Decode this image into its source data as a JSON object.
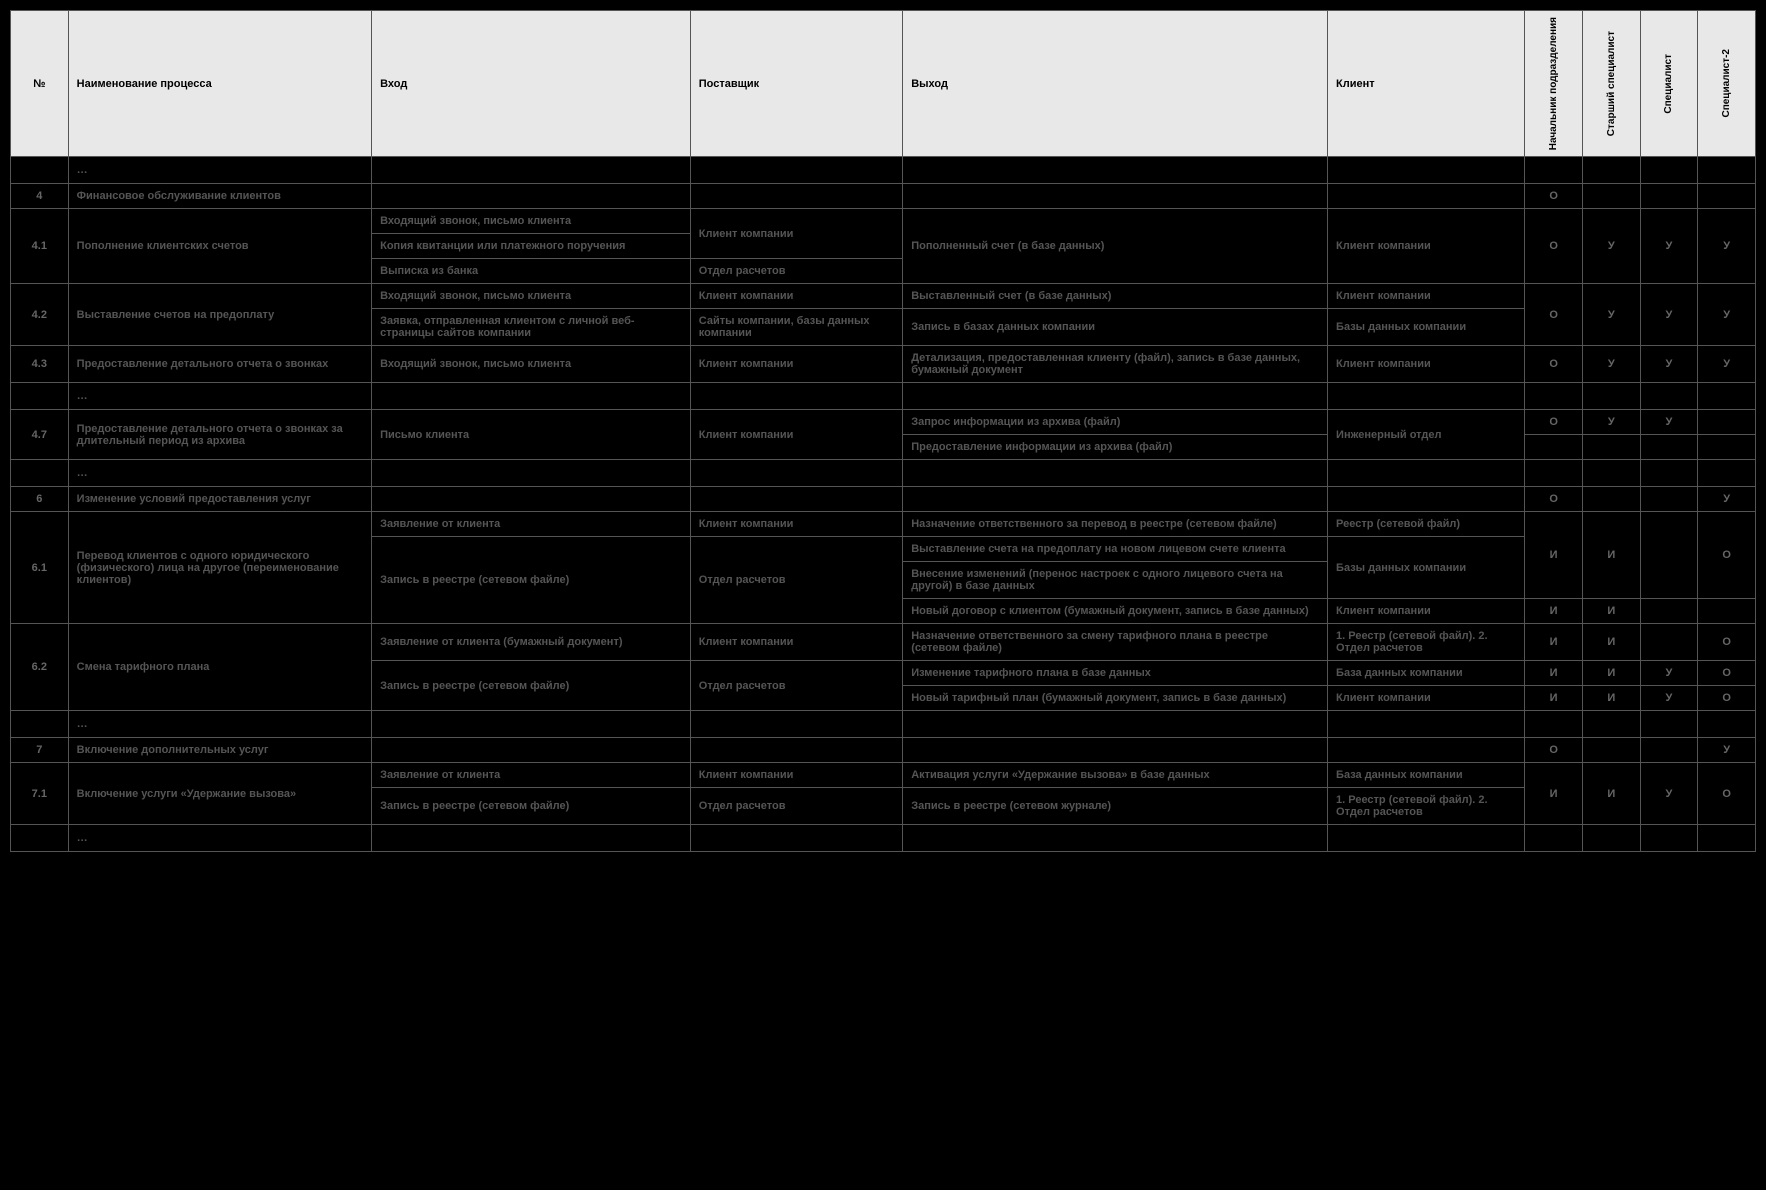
{
  "headers": {
    "num": "№",
    "name": "Наименование процесса",
    "input": "Вход",
    "supplier": "Поставщик",
    "output": "Выход",
    "client": "Клиент",
    "role1": "Начальник подразделения",
    "role2": "Старший специалист",
    "role3": "Специалист",
    "role4": "Специалист-2"
  },
  "rows": [
    {
      "type": "ellipsis",
      "text": "…"
    },
    {
      "type": "section",
      "num": "4",
      "name": "Финансовое обслуживание клиентов",
      "r1": "О",
      "r2": "",
      "r3": "",
      "r4": ""
    },
    {
      "type": "proc",
      "num": "4.1",
      "name": "Пополнение клиентских счетов",
      "subs": [
        {
          "input": "Входящий звонок, письмо клиента",
          "supplier": "Клиент компании",
          "output": "Пополненный счет (в базе данных)",
          "client": "Клиент компании"
        },
        {
          "input": "Копия квитанции или платежного поручения",
          "supplier": "",
          "output": "",
          "client": ""
        },
        {
          "input": "Выписка из банка",
          "supplier": "Отдел расчетов",
          "output": "",
          "client": ""
        }
      ],
      "r1": "О",
      "r2": "У",
      "r3": "У",
      "r4": "У",
      "merge": [
        {
          "col": "supplier",
          "from": 0,
          "span": 2
        },
        {
          "col": "output",
          "from": 0,
          "span": 3
        },
        {
          "col": "client",
          "from": 0,
          "span": 3
        }
      ]
    },
    {
      "type": "proc",
      "num": "4.2",
      "name": "Выставление счетов на предоплату",
      "subs": [
        {
          "input": "Входящий звонок, письмо клиента",
          "supplier": "Клиент компании",
          "output": "Выставленный счет (в базе данных)",
          "client": "Клиент компании"
        },
        {
          "input": "Заявка, отправленная клиентом с личной веб-страницы сайтов компании",
          "supplier": "Сайты компании, базы данных компании",
          "output": "Запись в базах данных компании",
          "client": "Базы данных  компании"
        }
      ],
      "r1": "О",
      "r2": "У",
      "r3": "У",
      "r4": "У"
    },
    {
      "type": "proc",
      "num": "4.3",
      "name": "Предоставление детального отчета о звонках",
      "subs": [
        {
          "input": "Входящий звонок, письмо клиента",
          "supplier": "Клиент компании",
          "output": "Детализация, предоставленная клиенту (файл), запись в базе данных, бумажный документ",
          "client": "Клиент компании"
        }
      ],
      "r1": "О",
      "r2": "У",
      "r3": "У",
      "r4": "У"
    },
    {
      "type": "ellipsis",
      "text": "…"
    },
    {
      "type": "proc",
      "num": "4.7",
      "name": "Предоставление детального отчета о звонках за длительный период из архива",
      "subs": [
        {
          "input": "Письмо клиента",
          "supplier": "Клиент компании",
          "output": "Запрос информации из архива (файл)",
          "client": "Инженерный отдел",
          "r1": "О",
          "r2": "У",
          "r3": "У",
          "r4": ""
        },
        {
          "input": "",
          "supplier": "",
          "output": "Предоставление информации из архива (файл)",
          "client": "",
          "r1": "",
          "r2": "",
          "r3": "",
          "r4": ""
        }
      ],
      "merge": [
        {
          "col": "input",
          "from": 0,
          "span": 2
        },
        {
          "col": "supplier",
          "from": 0,
          "span": 2
        },
        {
          "col": "client",
          "from": 0,
          "span": 2
        }
      ],
      "rolemode": "perrow"
    },
    {
      "type": "ellipsis",
      "text": "…"
    },
    {
      "type": "section",
      "num": "6",
      "name": "Изменение условий предоставления услуг",
      "r1": "О",
      "r2": "",
      "r3": "",
      "r4": "У"
    },
    {
      "type": "proc",
      "num": "6.1",
      "name": "Перевод клиентов с одного юридического (физического) лица на другое (переименование клиентов)",
      "subs": [
        {
          "input": "Заявление от клиента",
          "supplier": "Клиент компании",
          "output": "Назначение ответственного за перевод в реестре (сетевом файле)",
          "client": "Реестр (сетевой файл)",
          "r1": "И",
          "r2": "И",
          "r3": "",
          "r4": "О"
        },
        {
          "input": "Запись в реестре (сетевом файле)",
          "supplier": "Отдел расчетов",
          "output": "Выставление счета на предоплату на новом лицевом счете клиента",
          "client": "Базы данных  компании"
        },
        {
          "input": "",
          "supplier": "",
          "output": "Внесение изменений (перенос настроек с одного лицевого счета на другой)  в базе данных",
          "client": ""
        },
        {
          "input": "",
          "supplier": "",
          "output": "Новый договор с клиентом (бумажный документ, запись в базе данных)",
          "client": "Клиент компании",
          "r1": "И",
          "r2": "И",
          "r3": "",
          "r4": ""
        }
      ],
      "merge": [
        {
          "col": "input",
          "from": 1,
          "span": 3
        },
        {
          "col": "supplier",
          "from": 1,
          "span": 3
        },
        {
          "col": "client",
          "from": 1,
          "span": 2
        }
      ],
      "rolemode": "custom",
      "rolespans": [
        3,
        1
      ]
    },
    {
      "type": "proc",
      "num": "6.2",
      "name": "Смена тарифного плана",
      "subs": [
        {
          "input": "Заявление от клиента (бумажный документ)",
          "supplier": "Клиент компании",
          "output": "Назначение ответственного за смену тарифного плана в реестре (сетевом файле)",
          "client": "1. Реестр (сетевой файл). 2. Отдел расчетов",
          "r1": "И",
          "r2": "И",
          "r3": "",
          "r4": "О"
        },
        {
          "input": "Запись в реестре (сетевом файле)",
          "supplier": "Отдел расчетов",
          "output": "Изменение тарифного плана  в базе данных",
          "client": "База данных компании",
          "r1": "И",
          "r2": "И",
          "r3": "У",
          "r4": "О"
        },
        {
          "input": "",
          "supplier": "",
          "output": "Новый тарифный план (бумажный документ, запись в базе данных)",
          "client": "Клиент компании",
          "r1": "И",
          "r2": "И",
          "r3": "У",
          "r4": "О"
        }
      ],
      "merge": [
        {
          "col": "input",
          "from": 1,
          "span": 2
        },
        {
          "col": "supplier",
          "from": 1,
          "span": 2
        }
      ],
      "rolemode": "perrow"
    },
    {
      "type": "ellipsis",
      "text": "…"
    },
    {
      "type": "section",
      "num": "7",
      "name": "Включение дополнительных услуг",
      "r1": "О",
      "r2": "",
      "r3": "",
      "r4": "У"
    },
    {
      "type": "proc",
      "num": "7.1",
      "name": "Включение услуги «Удержание вызова»",
      "subs": [
        {
          "input": "Заявление от клиента",
          "supplier": "Клиент компании",
          "output": "Активация услуги «Удержание вызова» в базе данных",
          "client": "База данных компании"
        },
        {
          "input": "Запись в реестре (сетевом файле)",
          "supplier": "Отдел расчетов",
          "output": "Запись в реестре (сетевом журнале)",
          "client": "1. Реестр (сетевой файл). 2. Отдел расчетов"
        }
      ],
      "r1": "И",
      "r2": "И",
      "r3": "У",
      "r4": "О"
    },
    {
      "type": "ellipsis",
      "text": "…"
    }
  ]
}
